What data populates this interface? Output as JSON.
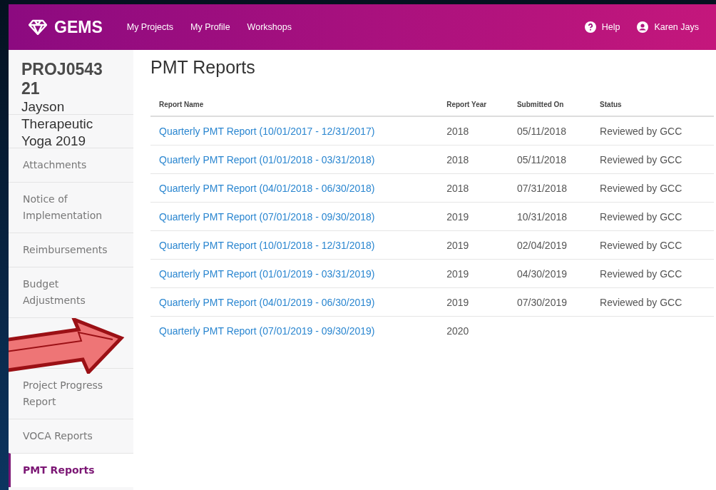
{
  "app": {
    "logo": "GEMS"
  },
  "nav": [
    {
      "label": "My Projects"
    },
    {
      "label": "My Profile"
    },
    {
      "label": "Workshops"
    }
  ],
  "help": {
    "label": "Help"
  },
  "user": {
    "name": "Karen Jays"
  },
  "project": {
    "code": "PROJ0543\n21",
    "name": "Jayson\nTherapeutic\nYoga 2019"
  },
  "sidebar": {
    "items": [
      {
        "kind": "hidden"
      },
      {
        "label": "Attachments",
        "selected": false
      },
      {
        "label": "Notice of Implementation",
        "selected": false
      },
      {
        "label": "Reimbursements",
        "selected": false
      },
      {
        "label": "Budget Adjustments",
        "selected": false
      },
      {
        "kind": "hidden_tall"
      },
      {
        "label": "Project Progress Report",
        "selected": false
      },
      {
        "label": "VOCA Reports",
        "selected": false
      },
      {
        "label": "PMT Reports",
        "selected": true
      }
    ]
  },
  "page_title": "PMT Reports",
  "table": {
    "columns": [
      "Report Name",
      "Report Year",
      "Submitted On",
      "Status"
    ],
    "rows": [
      [
        "Quarterly PMT Report (10/01/2017 - 12/31/2017)",
        "2018",
        "05/11/2018",
        "Reviewed by GCC"
      ],
      [
        "Quarterly PMT Report (01/01/2018 - 03/31/2018)",
        "2018",
        "05/11/2018",
        "Reviewed by GCC"
      ],
      [
        "Quarterly PMT Report (04/01/2018 - 06/30/2018)",
        "2018",
        "07/31/2018",
        "Reviewed by GCC"
      ],
      [
        "Quarterly PMT Report (07/01/2018 - 09/30/2018)",
        "2019",
        "10/31/2018",
        "Reviewed by GCC"
      ],
      [
        "Quarterly PMT Report (10/01/2018 - 12/31/2018)",
        "2019",
        "02/04/2019",
        "Reviewed by GCC"
      ],
      [
        "Quarterly PMT Report (01/01/2019 - 03/31/2019)",
        "2019",
        "04/30/2019",
        "Reviewed by GCC"
      ],
      [
        "Quarterly PMT Report (04/01/2019 - 06/30/2019)",
        "2019",
        "07/30/2019",
        "Reviewed by GCC"
      ],
      [
        "Quarterly PMT Report (07/01/2019 - 09/30/2019)",
        "2020",
        "",
        ""
      ]
    ]
  }
}
